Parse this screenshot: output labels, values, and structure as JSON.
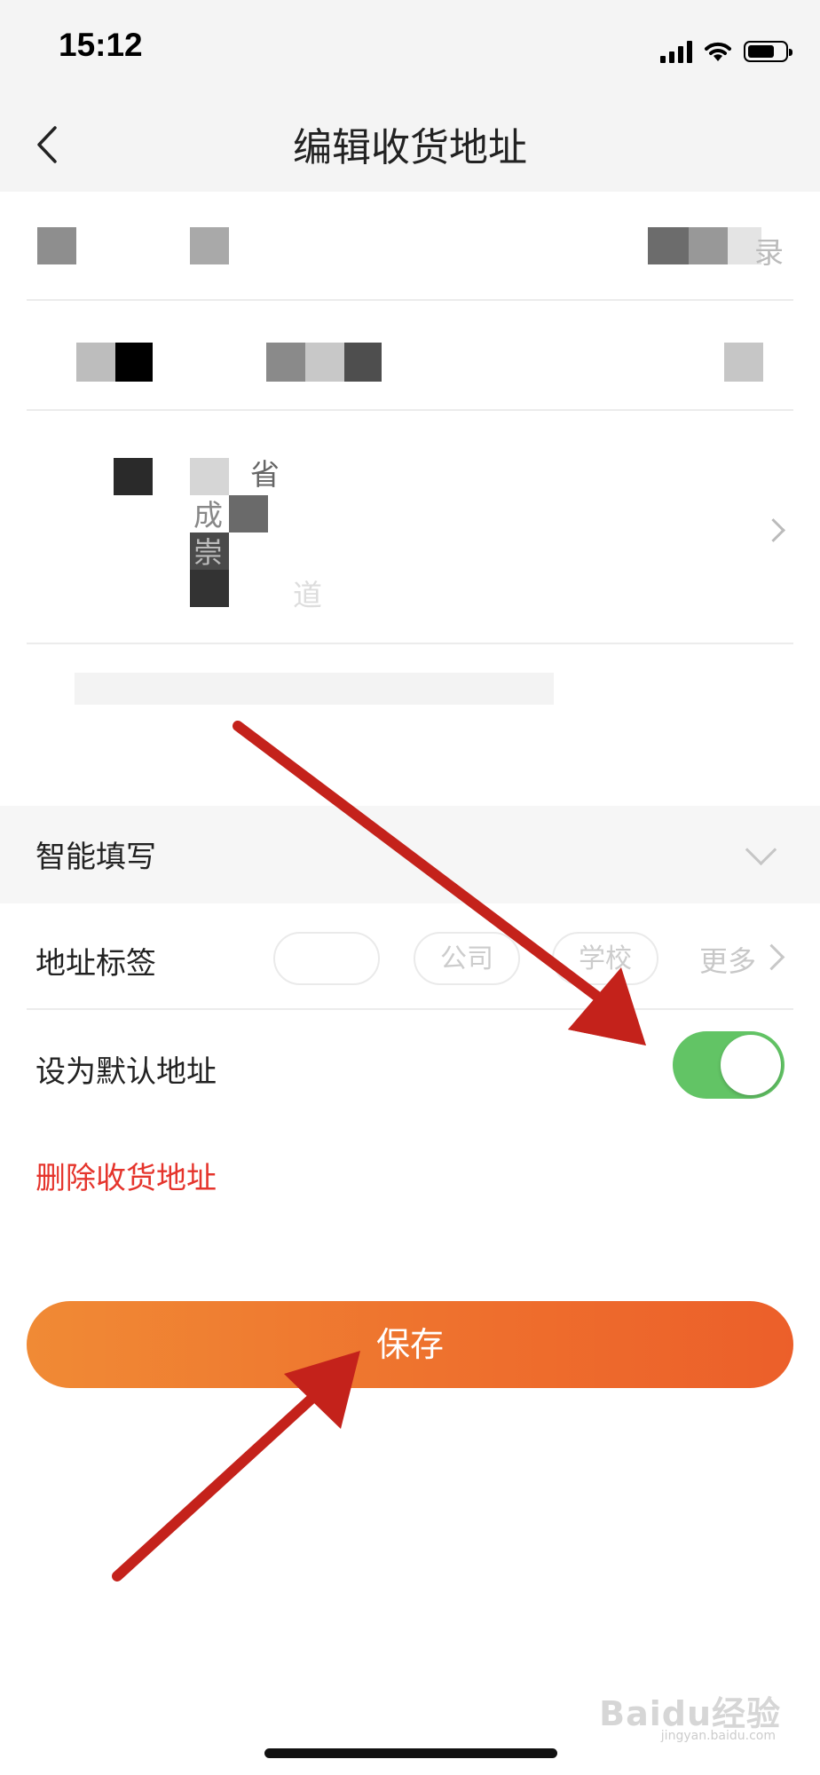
{
  "status_bar": {
    "time": "15:12"
  },
  "nav": {
    "title": "编辑收货地址"
  },
  "form": {
    "address_suffix_province": "省",
    "address_partial_1": "成",
    "address_partial_2": "崇",
    "address_partial_3": "道",
    "contact_suffix": "录"
  },
  "smart_fill": {
    "label": "智能填写"
  },
  "address_tag": {
    "label": "地址标签",
    "tags": [
      "",
      "公司",
      "学校"
    ],
    "more": "更多"
  },
  "default_address": {
    "label": "设为默认地址",
    "enabled": true
  },
  "delete": {
    "label": "删除收货地址"
  },
  "save": {
    "label": "保存"
  },
  "watermark": {
    "text": "Baidu经验",
    "sub": "jingyan.baidu.com"
  },
  "colors": {
    "toggle_on": "#62c465",
    "delete_red": "#e5342c",
    "save_gradient_start": "#f08a35",
    "save_gradient_end": "#ec5f2a",
    "annotation_arrow": "#c4221b"
  }
}
